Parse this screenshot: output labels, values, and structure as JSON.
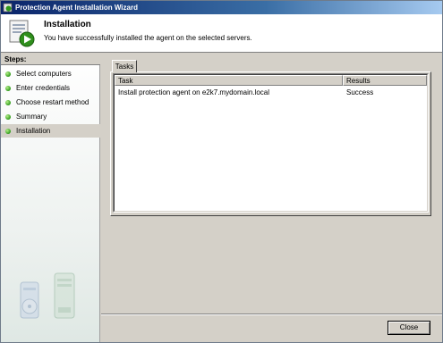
{
  "window": {
    "title": "Protection Agent Installation Wizard"
  },
  "header": {
    "title": "Installation",
    "subtitle": "You have successfully installed the agent on the selected servers."
  },
  "sidebar": {
    "title": "Steps:",
    "items": [
      {
        "label": "Select computers",
        "status_color": "#2f9a1a"
      },
      {
        "label": "Enter credentials",
        "status_color": "#2f9a1a"
      },
      {
        "label": "Choose restart method",
        "status_color": "#2f9a1a"
      },
      {
        "label": "Summary",
        "status_color": "#2f9a1a"
      },
      {
        "label": "Installation",
        "status_color": "#2f9a1a",
        "active": true
      }
    ]
  },
  "tabs": [
    {
      "label": "Tasks"
    }
  ],
  "table": {
    "columns": [
      "Task",
      "Results"
    ],
    "rows": [
      [
        "Install protection agent on e2k7.mydomain.local",
        "Success"
      ]
    ]
  },
  "buttons": {
    "close_label": "Close"
  }
}
